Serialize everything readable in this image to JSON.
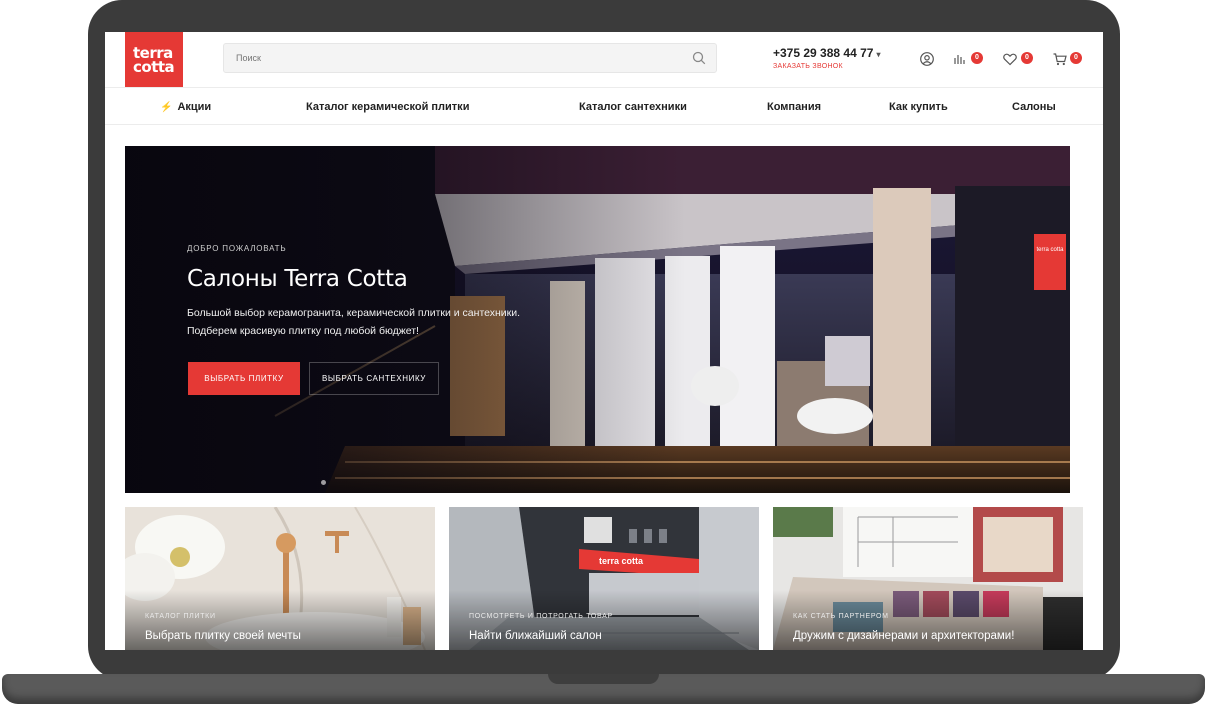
{
  "brand": {
    "line1": "terra",
    "line2": "cotta",
    "accent": "#e53935"
  },
  "search": {
    "placeholder": "Поиск",
    "icon": "search-icon"
  },
  "contact": {
    "phone": "+375 29 388 44 77",
    "callback": "ЗАКАЗАТЬ ЗВОНОК"
  },
  "header_icons": {
    "account": "user-icon",
    "compare": {
      "icon": "compare-icon",
      "count": "0"
    },
    "favorites": {
      "icon": "heart-icon",
      "count": "0"
    },
    "cart": {
      "icon": "cart-icon",
      "count": "0"
    }
  },
  "nav": {
    "promo_icon": "lightning-icon",
    "items": [
      "Акции",
      "Каталог керамической плитки",
      "Каталог сантехники",
      "Компания",
      "Как купить",
      "Салоны"
    ]
  },
  "hero": {
    "eyebrow": "ДОБРО ПОЖАЛОВАТЬ",
    "title": "Салоны Terra Cotta",
    "desc_line1": "Большой выбор керамогранита, керамической плитки и сантехники.",
    "desc_line2": "Подберем красивую плитку под любой бюджет!",
    "primary_button": "ВЫБРАТЬ ПЛИТКУ",
    "secondary_button": "ВЫБРАТЬ САНТЕХНИКУ",
    "store_sign": "terra cotta"
  },
  "cards": [
    {
      "eyebrow": "КАТАЛОГ ПЛИТКИ",
      "title": "Выбрать плитку своей мечты"
    },
    {
      "eyebrow": "ПОСМОТРЕТЬ И ПОТРОГАТЬ ТОВАР",
      "title": "Найти ближайший салон",
      "sign": "terra cotta"
    },
    {
      "eyebrow": "КАК СТАТЬ ПАРТНЕРОМ",
      "title": "Дружим с дизайнерами и архитекторами!"
    }
  ]
}
